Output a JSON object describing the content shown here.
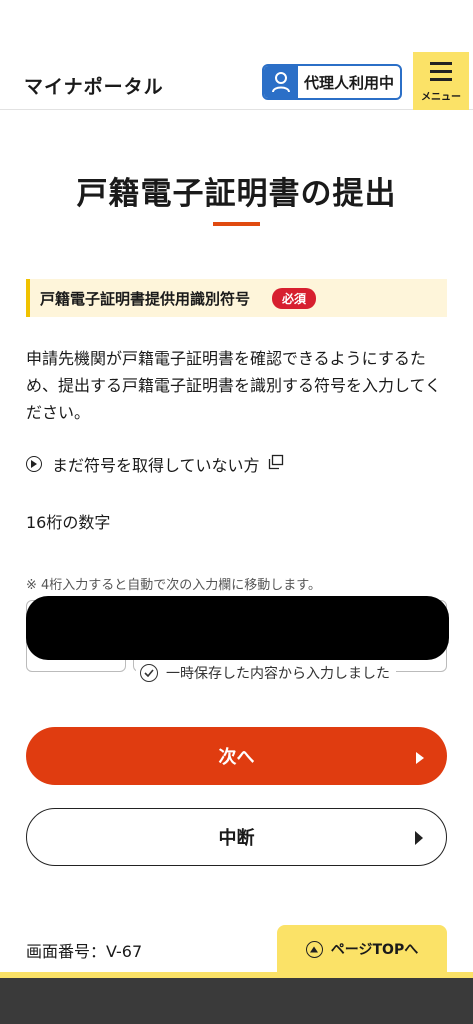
{
  "header": {
    "app_title": "マイナポータル",
    "proxy_button_label": "代理人利用中",
    "menu_label": "メニュー"
  },
  "page": {
    "title": "戸籍電子証明書の提出"
  },
  "section": {
    "title": "戸籍電子証明書提供用識別符号",
    "required_badge": "必須",
    "description": "申請先機関が戸籍電子証明書を確認できるようにするため、提出する戸籍電子証明書を識別する符号を入力してください。",
    "help_link": "まだ符号を取得していない方",
    "field_label": "16桁の数字",
    "note": "※ 4桁入力すると自動で次の入力欄に移動します。",
    "saved_note": "一時保存した内容から入力しました"
  },
  "buttons": {
    "next": "次へ",
    "stop": "中断"
  },
  "footer": {
    "screen_number": "画面番号：V-67",
    "page_top": "ページTOPへ"
  },
  "colors": {
    "accent": "#e03c10",
    "brand_yellow": "#fbe267",
    "proxy_blue": "#2b6fc7",
    "required_red": "#d71f2f"
  },
  "icons": {
    "proxy": "person-icon",
    "menu": "hamburger-icon",
    "help": "play-circle-icon",
    "external": "external-window-icon",
    "saved": "check-circle-icon",
    "next": "triangle-right-icon",
    "page_top": "arrow-up-circle-icon"
  }
}
